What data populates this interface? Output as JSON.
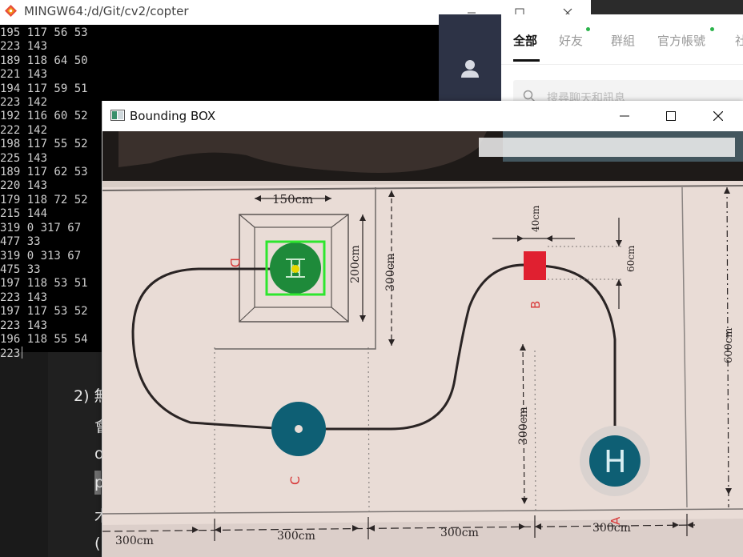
{
  "document": {
    "lines": [
      "2) 無",
      "會",
      "o",
      "p",
      "木",
      "("
    ]
  },
  "terminal": {
    "title": "MINGW64:/d/Git/cv2/copter",
    "icon": "git-diamond-icon",
    "output_lines": [
      "195 117 56 53",
      "223 143",
      "189 118 64 50",
      "221 143",
      "194 117 59 51",
      "223 142",
      "192 116 60 52",
      "222 142",
      "198 117 55 52",
      "225 143",
      "189 117 62 53",
      "220 143",
      "179 118 72 52",
      "215 144",
      "319 0 317 67",
      "477 33",
      "319 0 313 67",
      "475 33",
      "197 118 53 51",
      "223 143",
      "197 117 53 52",
      "223 143",
      "196 118 55 54",
      "223"
    ]
  },
  "chat": {
    "tabs": [
      {
        "label": "全部",
        "active": true,
        "dot": false
      },
      {
        "label": "好友",
        "active": false,
        "dot": true
      },
      {
        "label": "群組",
        "active": false,
        "dot": false
      },
      {
        "label": "官方帳號",
        "active": false,
        "dot": true
      },
      {
        "label": "社",
        "active": false,
        "dot": false
      }
    ],
    "search_placeholder": "搜尋聊天和訊息"
  },
  "cv_window": {
    "title": "Bounding BOX",
    "map": {
      "dim_150": "150cm",
      "dim_200": "200cm",
      "dim_300_vertical": "300cm",
      "dim_40": "40cm",
      "dim_60": "60cm",
      "dim_600": "600cm",
      "dim_300_mid": "300cm",
      "bottom_dims": [
        "300cm",
        "300cm",
        "300cm",
        "300cm"
      ],
      "label_a": "A",
      "label_b": "B",
      "label_c": "C",
      "label_d": "D",
      "helipad_letter": "H",
      "helipad_d_letter": "H"
    }
  },
  "colors": {
    "terminal_bg": "#000000",
    "terminal_text": "#cfcfcf",
    "chat_sidebar": "#2d3346",
    "chat_dot": "#2ab34a",
    "map_paper": "#e9dcd6",
    "track_line": "#2a2424",
    "pad_teal": "#0e5f74",
    "pad_green": "#1e8a3a",
    "bbox_green": "#2ee62e",
    "marker_red": "#e02030",
    "label_red": "#d83838"
  }
}
